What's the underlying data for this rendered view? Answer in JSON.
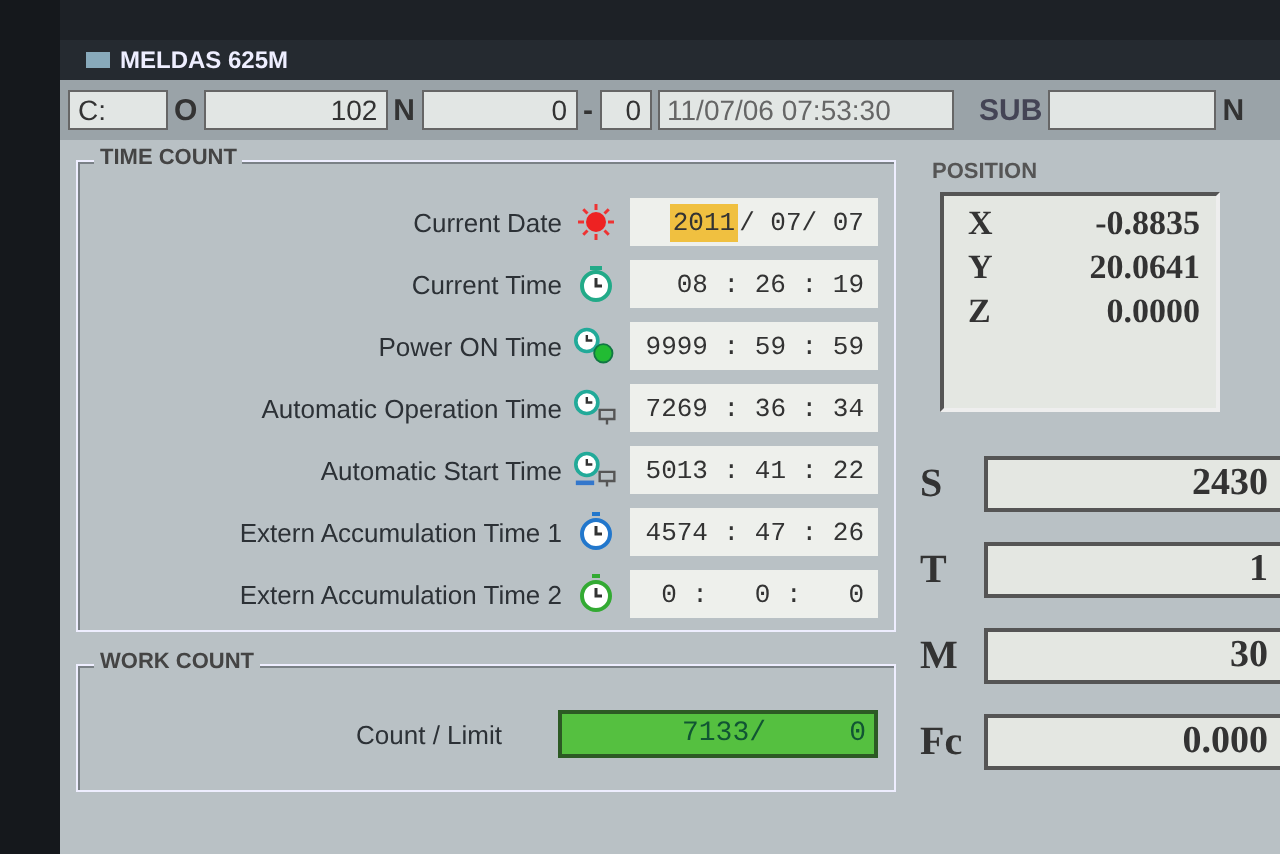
{
  "window": {
    "title": "MELDAS 625M"
  },
  "header": {
    "c_field": "C:",
    "o_label": "O",
    "o_value": "102",
    "n_label": "N",
    "n_value": "0",
    "dash": "-",
    "seq_value": "0",
    "datetime": "11/07/06 07:53:30",
    "sub_label": "SUB",
    "n2_label": "N"
  },
  "time_count": {
    "title": "TIME COUNT",
    "rows": [
      {
        "label": "Current Date",
        "kind": "sun",
        "segments": [
          {
            "text": "2011",
            "selected": true
          },
          {
            "text": "/ 07/ 07",
            "selected": false
          }
        ]
      },
      {
        "label": "Current Time",
        "kind": "alarm",
        "segments": [
          {
            "text": "08 : 26 : 19",
            "selected": false
          }
        ]
      },
      {
        "label": "Power ON Time",
        "kind": "power",
        "segments": [
          {
            "text": "9999 : 59 : 59",
            "selected": false
          }
        ]
      },
      {
        "label": "Automatic Operation Time",
        "kind": "operation",
        "segments": [
          {
            "text": "7269 : 36 : 34",
            "selected": false
          }
        ]
      },
      {
        "label": "Automatic Start Time",
        "kind": "start",
        "segments": [
          {
            "text": "5013 : 41 : 22",
            "selected": false
          }
        ]
      },
      {
        "label": "Extern Accumulation Time 1",
        "kind": "stopwatch-blue",
        "segments": [
          {
            "text": "4574 : 47 : 26",
            "selected": false
          }
        ]
      },
      {
        "label": "Extern Accumulation Time 2",
        "kind": "stopwatch-green",
        "segments": [
          {
            "text": "0 :   0 :   0",
            "selected": false
          }
        ]
      }
    ]
  },
  "work_count": {
    "title": "WORK COUNT",
    "label": "Count / Limit",
    "count": "7133/",
    "limit": "0"
  },
  "position": {
    "title": "POSITION",
    "axes": [
      {
        "axis": "X",
        "value": "-0.8835"
      },
      {
        "axis": "Y",
        "value": "20.0641"
      },
      {
        "axis": "Z",
        "value": "0.0000"
      }
    ]
  },
  "modal": [
    {
      "label": "S",
      "value": "2430"
    },
    {
      "label": "T",
      "value": "1"
    },
    {
      "label": "M",
      "value": "30"
    },
    {
      "label": "Fc",
      "value": "0.000"
    }
  ]
}
